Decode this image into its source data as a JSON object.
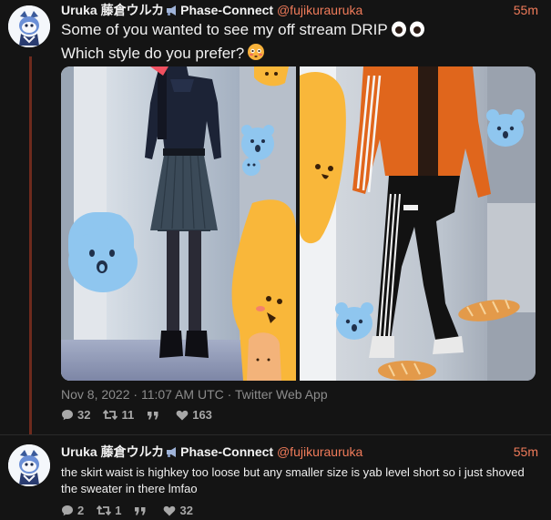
{
  "tweet1": {
    "author_name": "Uruka 藤倉ウルカ",
    "affiliation": "Phase-Connect",
    "handle": "@fujikurauruka",
    "time_ago": "55m",
    "text_line1": "Some of you wanted to see my off stream DRIP",
    "text_line2": "Which style do you prefer?",
    "date": "Nov 8, 2022",
    "time": "11:07 AM UTC",
    "client": "Twitter Web App",
    "separator": " · ",
    "stats": {
      "replies": "32",
      "retweets": "11",
      "quotes": "",
      "likes": "163"
    }
  },
  "tweet2": {
    "author_name": "Uruka 藤倉ウルカ",
    "affiliation": "Phase-Connect",
    "handle": "@fujikurauruka",
    "time_ago": "55m",
    "text": "the skirt waist is highkey too loose but any smaller size is yab level short so i just shoved the sweater in there lmfao",
    "stats": {
      "replies": "2",
      "retweets": "1",
      "quotes": "",
      "likes": "32"
    }
  },
  "icons": [
    "avatar",
    "megaphone-icon",
    "eyes-emoji-icon",
    "flushed-face-emoji-icon",
    "reply-icon",
    "retweet-icon",
    "quote-icon",
    "like-icon"
  ],
  "colors": {
    "background": "#141414",
    "accent": "#f07b5a",
    "thread_line": "#6e2a1d",
    "muted": "#8c8c8c"
  }
}
